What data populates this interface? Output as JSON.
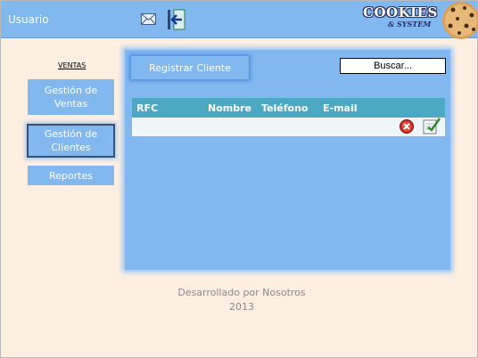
{
  "header": {
    "user_label": "Usuario",
    "logo_word": "COOKIES",
    "logo_sub": "& SYSTEM"
  },
  "nav": {
    "section_title": "VENTAS",
    "items": [
      {
        "label_line1": "Gestión de",
        "label_line2": "Ventas"
      },
      {
        "label_line1": "Gestión de",
        "label_line2": "Clientes",
        "active": true
      },
      {
        "label_line1": "Reportes",
        "label_line2": ""
      }
    ]
  },
  "main": {
    "register_label": "Registrar Cliente",
    "search_value": "Buscar...",
    "table": {
      "columns": [
        "RFC",
        "Nombre",
        "Teléfono",
        "E-mail"
      ],
      "rows": [
        [
          "",
          "",
          "",
          ""
        ]
      ]
    }
  },
  "footer": {
    "line1": "Desarrollado por Nosotros",
    "line2": "2013"
  },
  "colors": {
    "header_bg": "#82b8f0",
    "page_bg": "#fdeee2",
    "panel_bg": "#82b8f0",
    "table_header": "#4da8c3"
  },
  "icons": [
    "mail-icon",
    "logout-icon",
    "cookie-icon",
    "delete-icon",
    "edit-icon"
  ]
}
